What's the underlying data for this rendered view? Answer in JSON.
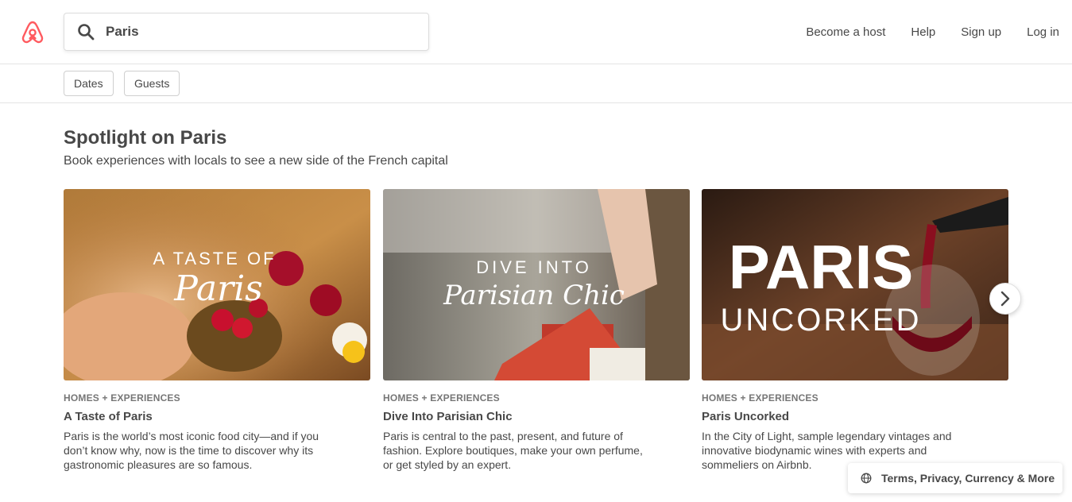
{
  "colors": {
    "brand": "#FF5A5F",
    "text": "#484848",
    "muted": "#767676"
  },
  "header": {
    "logo_icon": "airbnb-logo-icon",
    "search": {
      "icon": "search-icon",
      "value": "Paris"
    },
    "nav": [
      {
        "label": "Become a host"
      },
      {
        "label": "Help"
      },
      {
        "label": "Sign up"
      },
      {
        "label": "Log in"
      }
    ]
  },
  "filters": [
    {
      "label": "Dates"
    },
    {
      "label": "Guests"
    }
  ],
  "section": {
    "title": "Spotlight on Paris",
    "subtitle": "Book experiences with locals to see a new side of the French capital"
  },
  "cards": [
    {
      "kicker": "HOMES + EXPERIENCES",
      "title": "A Taste of Paris",
      "description": "Paris is the world’s most iconic food city—and if you don’t know why, now is the time to discover why its gastronomic pleasures are so famous.",
      "image_text": [
        "A TASTE OF",
        "Paris"
      ]
    },
    {
      "kicker": "HOMES + EXPERIENCES",
      "title": "Dive Into Parisian Chic",
      "description": "Paris is central to the past, present, and future of fashion. Explore boutiques, make your own perfume, or get styled by an expert.",
      "image_text": [
        "DIVE INTO",
        "Parisian Chic"
      ]
    },
    {
      "kicker": "HOMES + EXPERIENCES",
      "title": "Paris Uncorked",
      "description": "In the City of Light, sample legendary vintages and innovative biodynamic wines with experts and sommeliers on Airbnb.",
      "image_text": [
        "PARIS",
        "UNCORKED"
      ]
    }
  ],
  "carousel": {
    "next_icon": "chevron-right-icon"
  },
  "footer": {
    "icon": "globe-icon",
    "label": "Terms, Privacy, Currency & More"
  }
}
